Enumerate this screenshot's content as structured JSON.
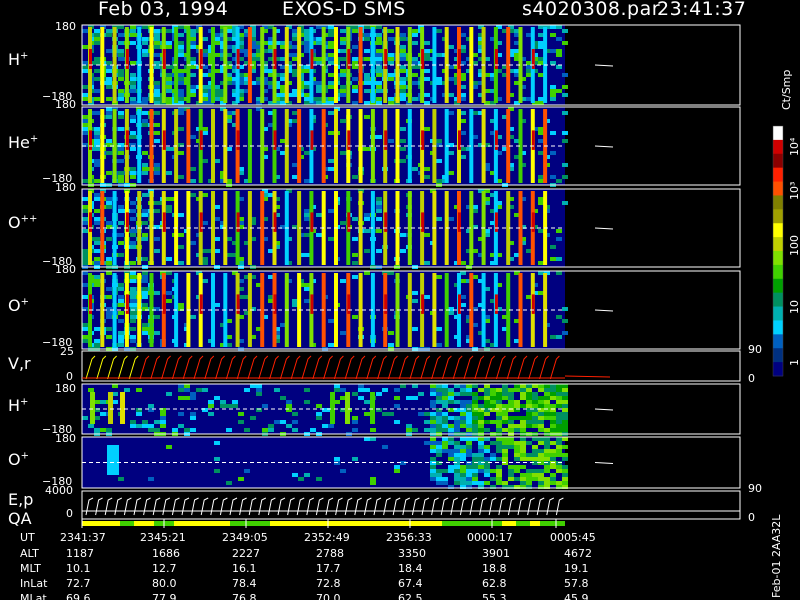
{
  "header": {
    "date": "Feb 03, 1994",
    "instrument": "EXOS-D SMS",
    "file": "s4020308.par",
    "time": "23:41:37"
  },
  "panels": [
    {
      "id": "hplus-1",
      "species": "H",
      "sup": "+",
      "ymax": "180",
      "ymin": "−180"
    },
    {
      "id": "heplus",
      "species": "He",
      "sup": "+",
      "ymax": "180",
      "ymin": "−180"
    },
    {
      "id": "oplusplus",
      "species": "O",
      "sup": "++",
      "ymax": "180",
      "ymin": "−180"
    },
    {
      "id": "oplus-1",
      "species": "O",
      "sup": "+",
      "ymax": "180",
      "ymin": "−180"
    },
    {
      "id": "vr",
      "species": "V,r",
      "sup": "",
      "ymax": "25",
      "ymin": "0",
      "right_top": "90",
      "right_bottom": "0"
    },
    {
      "id": "hplus-2",
      "species": "H",
      "sup": "+",
      "ymax": "180",
      "ymin": "−180"
    },
    {
      "id": "oplus-2",
      "species": "O",
      "sup": "+",
      "ymax": "180",
      "ymin": "−180"
    },
    {
      "id": "ep",
      "species": "E,p",
      "sup": "",
      "ymax": "4000",
      "ymin": "0",
      "right_top": "90",
      "right_bottom": "0"
    }
  ],
  "qa_label": "QA",
  "colorbar": {
    "title": "Ct/Smp",
    "ticks": [
      "10⁴",
      "10³",
      "100",
      "10",
      "1"
    ],
    "colors": [
      "#ffffff",
      "#d00000",
      "#8b0000",
      "#ff2000",
      "#ff5000",
      "#808000",
      "#a0a000",
      "#ffff00",
      "#c0d000",
      "#80e000",
      "#40d000",
      "#00a000",
      "#009060",
      "#00b0b0",
      "#00d0ff",
      "#0060c0",
      "#003080",
      "#000080"
    ]
  },
  "table": {
    "labels": [
      "UT",
      "ALT",
      "MLT",
      "InLat",
      "MLat"
    ],
    "columns": [
      [
        "2341:37",
        "1187",
        "10.1",
        "72.7",
        "69.6"
      ],
      [
        "2345:21",
        "1686",
        "12.7",
        "80.0",
        "77.9"
      ],
      [
        "2349:05",
        "2227",
        "16.1",
        "78.4",
        "76.8"
      ],
      [
        "2352:49",
        "2788",
        "17.7",
        "72.8",
        "70.0"
      ],
      [
        "2356:33",
        "3350",
        "18.4",
        "67.4",
        "62.5"
      ],
      [
        "0000:17",
        "3901",
        "18.8",
        "62.8",
        "55.3"
      ],
      [
        "0005:45",
        "4672",
        "19.1",
        "57.8",
        "45.9"
      ]
    ]
  },
  "side_caption": "Feb-01 2AA32L",
  "chart_data": {
    "type": "heatmap",
    "title": "Feb 03, 1994   EXOS-D SMS",
    "x": [
      "2341:37",
      "2345:21",
      "2349:05",
      "2352:49",
      "2356:33",
      "0000:17",
      "0005:45"
    ],
    "series": [
      {
        "name": "H+",
        "ylim": [
          -180,
          180
        ]
      },
      {
        "name": "He+",
        "ylim": [
          -180,
          180
        ]
      },
      {
        "name": "O++",
        "ylim": [
          -180,
          180
        ]
      },
      {
        "name": "O+",
        "ylim": [
          -180,
          180
        ]
      },
      {
        "name": "V,r",
        "ylim": [
          0,
          25
        ]
      },
      {
        "name": "H+",
        "ylim": [
          -180,
          180
        ]
      },
      {
        "name": "O+",
        "ylim": [
          -180,
          180
        ]
      },
      {
        "name": "E,p",
        "ylim": [
          0,
          4000
        ]
      }
    ],
    "colorbar_label": "Ct/Smp",
    "colorbar_ticks": [
      "1",
      "10",
      "100",
      "10³",
      "10⁴"
    ]
  }
}
